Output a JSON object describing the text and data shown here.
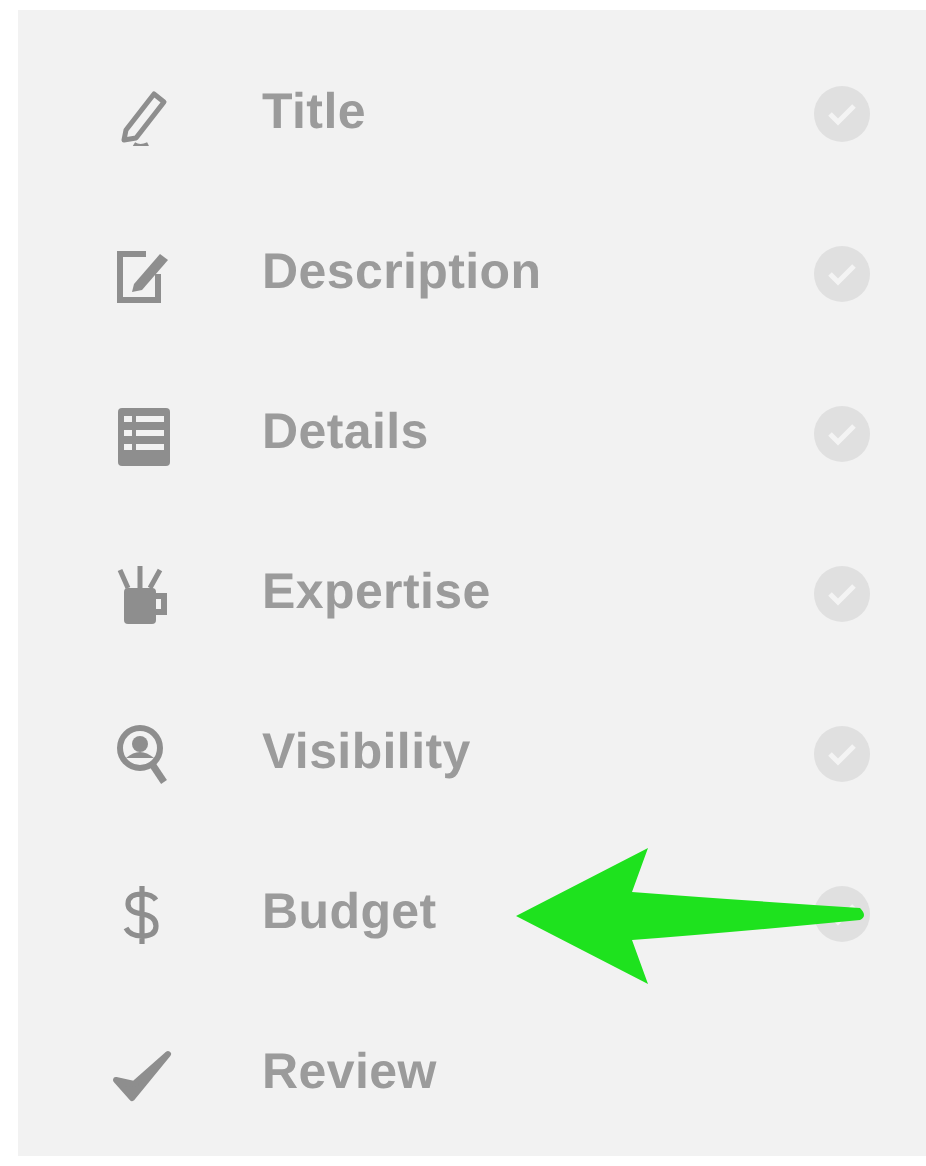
{
  "steps": [
    {
      "label": "Title",
      "completed": true,
      "highlighted": false
    },
    {
      "label": "Description",
      "completed": true,
      "highlighted": false
    },
    {
      "label": "Details",
      "completed": true,
      "highlighted": false
    },
    {
      "label": "Expertise",
      "completed": true,
      "highlighted": false
    },
    {
      "label": "Visibility",
      "completed": true,
      "highlighted": false
    },
    {
      "label": "Budget",
      "completed": true,
      "highlighted": true
    },
    {
      "label": "Review",
      "completed": false,
      "highlighted": false
    }
  ]
}
